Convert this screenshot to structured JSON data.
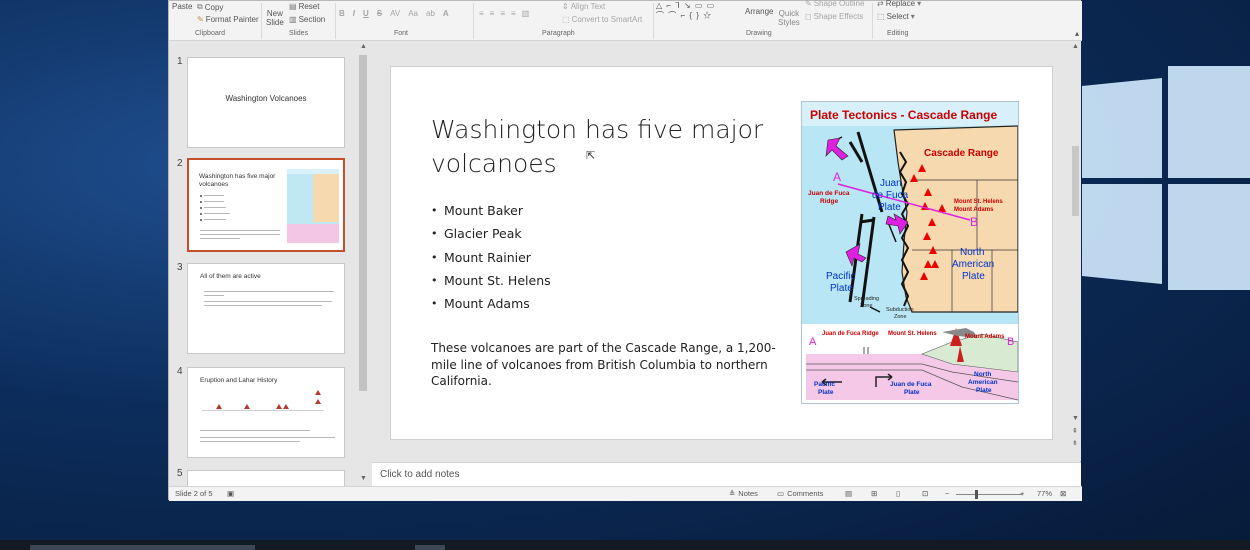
{
  "ribbon": {
    "clipboard": {
      "paste": "Paste",
      "copy": "Copy",
      "format_painter": "Format Painter",
      "label": "Clipboard"
    },
    "slides": {
      "new_slide_1": "New",
      "new_slide_2": "Slide",
      "reset": "Reset",
      "section": "Section",
      "label": "Slides"
    },
    "font": {
      "label": "Font",
      "bold": "B",
      "italic": "I",
      "underline": "U",
      "strike": "S",
      "aa": "Aa",
      "font_color": "A"
    },
    "paragraph": {
      "label": "Paragraph",
      "align_text": "Align Text",
      "smartart": "Convert to SmartArt"
    },
    "drawing": {
      "label": "Drawing",
      "arrange": "Arrange",
      "quick_1": "Quick",
      "quick_2": "Styles",
      "shape_outline": "Shape Outline",
      "shape_effects": "Shape Effects"
    },
    "editing": {
      "label": "Editing",
      "replace": "Replace",
      "select": "Select"
    }
  },
  "thumbnails": [
    {
      "num": "1",
      "title": "Washington Volcanoes"
    },
    {
      "num": "2",
      "title": "Washington has five major volcanoes"
    },
    {
      "num": "3",
      "title": "All of them are active"
    },
    {
      "num": "4",
      "title": "Eruption and Lahar History"
    },
    {
      "num": "5"
    }
  ],
  "slide": {
    "title": "Washington has five major volcanoes",
    "bullets": [
      "Mount Baker",
      "Glacier Peak",
      "Mount Rainier",
      "Mount St. Helens",
      "Mount Adams"
    ],
    "body": "These volcanoes are part of the Cascade Range, a 1,200-mile line of volcanoes from British Columbia to northern California.",
    "figure": {
      "title": "Plate Tectonics - Cascade Range",
      "cascade_range": "Cascade Range",
      "juan_de_fuca_1": "Juan",
      "juan_de_fuca_2": "de Fuca",
      "juan_de_fuca_3": "Plate",
      "jdf_ridge_1": "Juan de Fuca",
      "jdf_ridge_2": "Ridge",
      "st_helens": "Mount St. Helens",
      "adams": "Mount Adams",
      "north_american_1": "North",
      "north_american_2": "American",
      "north_american_3": "Plate",
      "pacific_1": "Pacific",
      "pacific_2": "Plate",
      "spreading_1": "Spreading",
      "spreading_2": "Zone",
      "subduction_1": "Subduction",
      "subduction_2": "Zone",
      "label_a": "A",
      "label_b": "B",
      "xs_ridge": "Juan de Fuca Ridge",
      "xs_helens": "Mount St. Helens",
      "xs_adams": "Mount Adams",
      "xs_a": "A",
      "xs_b": "B",
      "xs_pacific_1": "Pacific",
      "xs_pacific_2": "Plate",
      "xs_jdf_1": "Juan de Fuca",
      "xs_jdf_2": "Plate",
      "xs_na_1": "North",
      "xs_na_2": "American",
      "xs_na_3": "Plate"
    }
  },
  "notes": {
    "placeholder": "Click to add notes"
  },
  "status": {
    "slide_count": "Slide 2 of 5",
    "notes": "Notes",
    "comments": "Comments",
    "zoom": "77%"
  },
  "colors": {
    "selected_border": "#c3502a",
    "figure_title": "#cc0000",
    "ocean": "#b8e6f4",
    "land": "#f7d9b0",
    "arrows": "#e020e0"
  }
}
